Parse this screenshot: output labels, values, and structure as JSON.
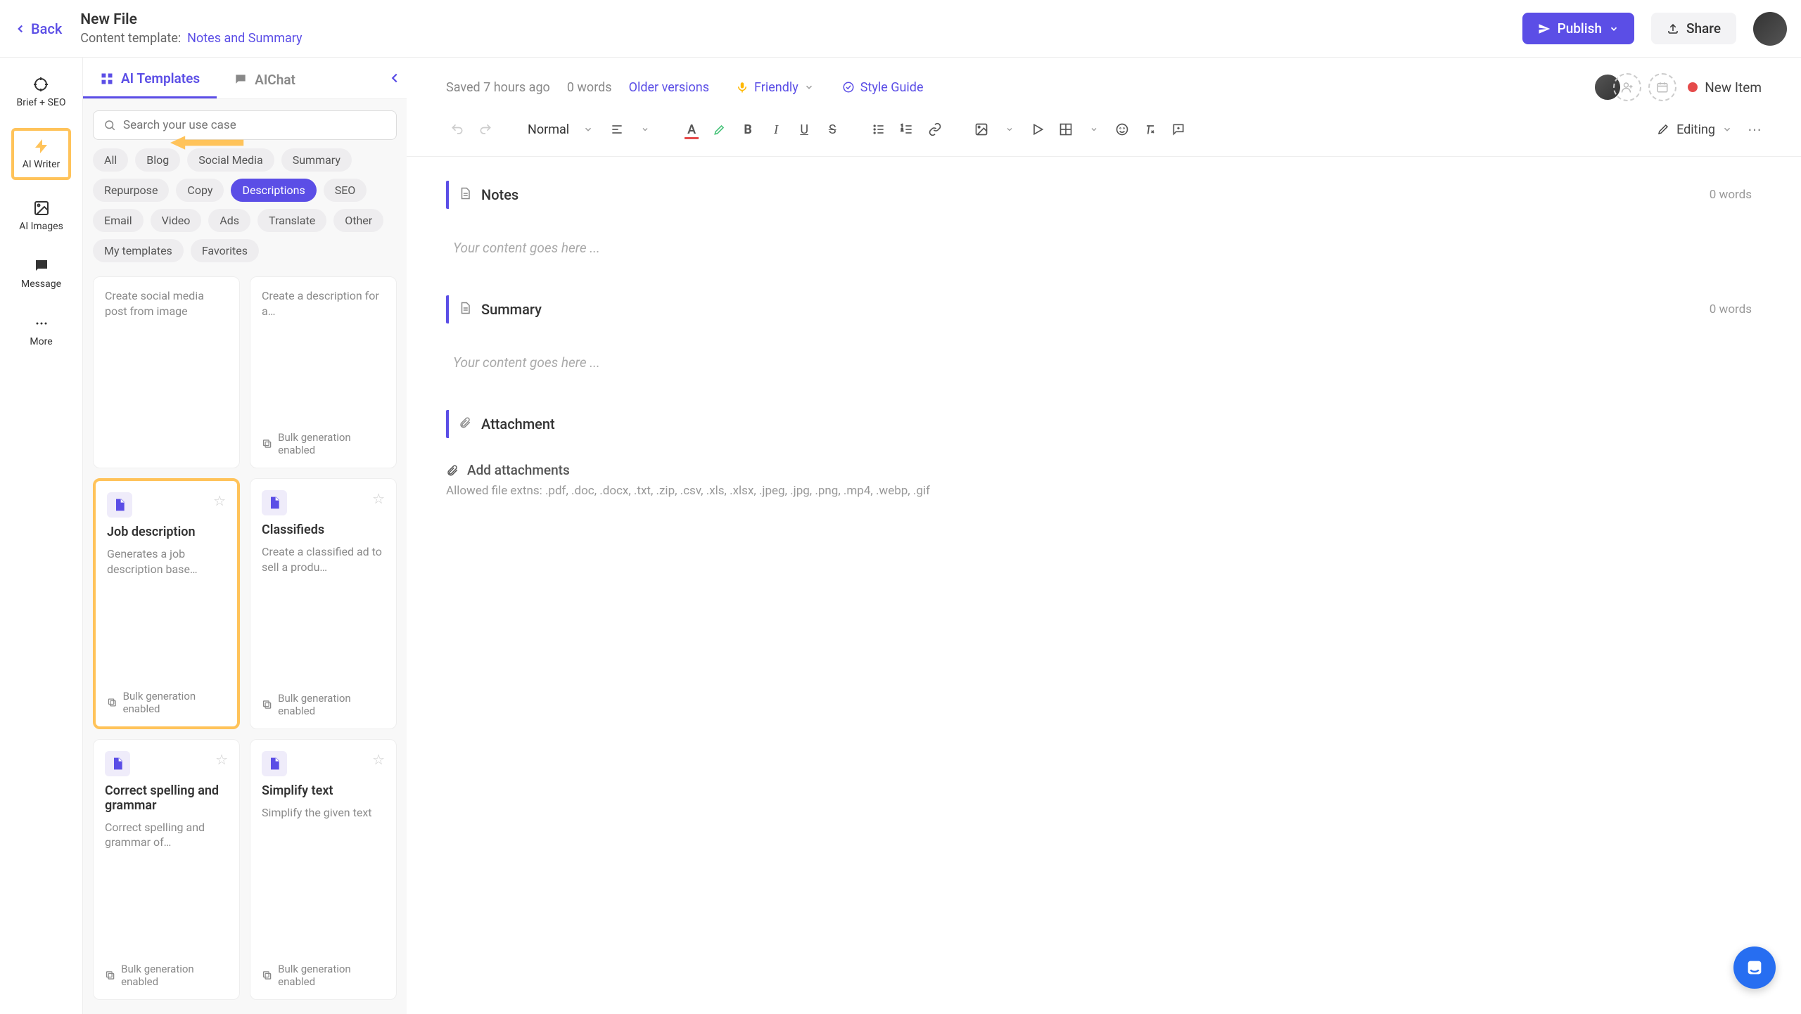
{
  "header": {
    "back_label": "Back",
    "title": "New File",
    "template_prefix": "Content template:",
    "template_name": "Notes and Summary",
    "publish_label": "Publish",
    "share_label": "Share"
  },
  "left_rail": {
    "brief": "Brief + SEO",
    "writer": "AI Writer",
    "images": "AI Images",
    "message": "Message",
    "more": "More"
  },
  "sidebar": {
    "tabs": {
      "templates": "AI Templates",
      "chat": "AIChat"
    },
    "search_placeholder": "Search your use case",
    "filters": [
      "All",
      "Blog",
      "Social Media",
      "Summary",
      "Repurpose",
      "Copy",
      "Descriptions",
      "SEO",
      "Email",
      "Video",
      "Ads",
      "Translate",
      "Other",
      "My templates",
      "Favorites"
    ],
    "active_filter": "Descriptions",
    "cards": [
      {
        "desc": "Create social media post from image",
        "bulk": false,
        "icon": false
      },
      {
        "desc": "Create a description for a…",
        "bulk": true,
        "icon": false
      },
      {
        "title": "Job description",
        "desc": "Generates a job description base…",
        "bulk": true,
        "icon": true,
        "highlight": true
      },
      {
        "title": "Classifieds",
        "desc": "Create a classified ad to sell a produ…",
        "bulk": true,
        "icon": true
      },
      {
        "title": "Correct spelling and grammar",
        "desc": "Correct spelling and grammar of…",
        "bulk": true,
        "icon": true
      },
      {
        "title": "Simplify text",
        "desc": "Simplify the given text",
        "bulk": true,
        "icon": true
      }
    ],
    "bulk_label": "Bulk generation enabled"
  },
  "editor": {
    "saved": "Saved 7 hours ago",
    "word_count": "0 words",
    "older_versions": "Older versions",
    "tone_label": "Friendly",
    "style_guide": "Style Guide",
    "new_item": "New Item",
    "para_style": "Normal",
    "mode": "Editing",
    "sections": [
      {
        "title": "Notes",
        "words": "0 words",
        "placeholder": "Your content goes here ..."
      },
      {
        "title": "Summary",
        "words": "0 words",
        "placeholder": "Your content goes here ..."
      }
    ],
    "attachment": {
      "title": "Attachment",
      "add_label": "Add attachments",
      "hint": "Allowed file extns: .pdf, .doc, .docx, .txt, .zip, .csv, .xls, .xlsx, .jpeg, .jpg, .png, .mp4, .webp, .gif"
    }
  }
}
